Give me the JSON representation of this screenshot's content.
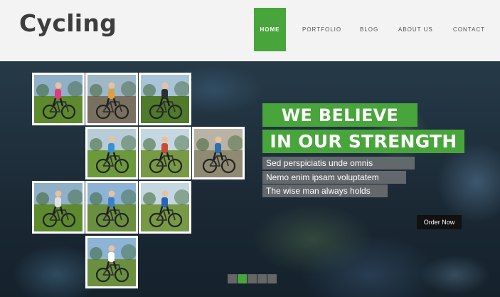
{
  "header": {
    "logo": "Cycling",
    "nav": [
      {
        "label": "HOME",
        "active": true
      },
      {
        "label": "PORTFOLIO",
        "active": false
      },
      {
        "label": "BLOG",
        "active": false
      },
      {
        "label": "ABOUT US",
        "active": false
      },
      {
        "label": "CONTACT",
        "active": false
      }
    ]
  },
  "hero": {
    "headline": [
      "WE BELIEVE",
      "IN OUR STRENGTH"
    ],
    "sublines": [
      "Sed perspiciatis unde omnis",
      "Nemo enim ipsam voluptatem",
      "The wise man always holds"
    ],
    "cta": "Order Now",
    "slider": {
      "count": 5,
      "active_index": 1
    }
  },
  "colors": {
    "accent": "#48a53b",
    "header_bg": "#f3f3f3",
    "logo": "#3d3d3d"
  },
  "gallery": [
    {
      "name": "girl-on-bike-photo",
      "scene": "grass"
    },
    {
      "name": "group-cyclists-photo",
      "scene": "road"
    },
    {
      "name": "mountain-cyclist-photo",
      "scene": "hill"
    },
    {
      "name": "kid-folding-bike-photo",
      "scene": "park"
    },
    {
      "name": "cyclists-field-photo",
      "scene": "field"
    },
    {
      "name": "racing-cyclist-photo",
      "scene": "blur"
    },
    {
      "name": "woman-mountain-bike-photo",
      "scene": "grass"
    },
    {
      "name": "girl-blue-bike-photo",
      "scene": "sky"
    },
    {
      "name": "cyclist-blue-jersey-photo",
      "scene": "field"
    },
    {
      "name": "cyclist-portrait-photo",
      "scene": "sky"
    }
  ]
}
